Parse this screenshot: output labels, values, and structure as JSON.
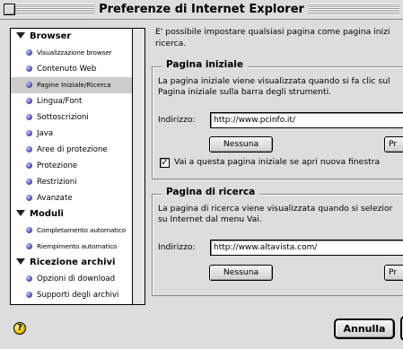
{
  "window": {
    "title": "Preferenze di Internet Explorer"
  },
  "sidebar": {
    "groups": [
      {
        "label": "Browser",
        "items": [
          {
            "label": "Visualizzazione browser"
          },
          {
            "label": "Contenuto Web"
          },
          {
            "label": "Pagine Iniziale/Ricerca"
          },
          {
            "label": "Lingua/Font"
          },
          {
            "label": "Sottoscrizioni"
          },
          {
            "label": "Java"
          },
          {
            "label": "Aree di protezione"
          },
          {
            "label": "Protezione"
          },
          {
            "label": "Restrizioni"
          },
          {
            "label": "Avanzate"
          }
        ]
      },
      {
        "label": "Moduli",
        "items": [
          {
            "label": "Completamento automatico"
          },
          {
            "label": "Riempimento automatico"
          }
        ]
      },
      {
        "label": "Ricezione archivi",
        "items": [
          {
            "label": "Opzioni di download"
          },
          {
            "label": "Supporti degli archivi"
          }
        ]
      }
    ],
    "selected": "Pagine Iniziale/Ricerca"
  },
  "main": {
    "intro_line1": "E' possibile impostare qualsiasi pagina come pagina inizi",
    "intro_line2": "ricerca.",
    "home": {
      "heading": "Pagina iniziale",
      "desc_line1": "La pagina iniziale viene visualizzata quando si fa clic sul",
      "desc_line2": "Pagina iniziale sulla barra degli strumenti.",
      "address_label": "Indirizzo:",
      "address_value": "http://www.pcinfo.it/",
      "none_button": "Nessuna",
      "cut_button": "Pr",
      "checkbox_mark": "✓",
      "checkbox_label": "Vai a questa pagina iniziale se apri nuova finestra"
    },
    "search": {
      "heading": "Pagina di ricerca",
      "desc_line1": "La pagina di ricerca viene visualizzata quando si selezior",
      "desc_line2": "su Internet dal menu Vai.",
      "address_label": "Indirizzo:",
      "address_value": "http://www.altavista.com/",
      "none_button": "Nessuna",
      "cut_button": "Pr"
    }
  },
  "footer": {
    "help_glyph": "?",
    "cancel_button": "Annulla"
  }
}
